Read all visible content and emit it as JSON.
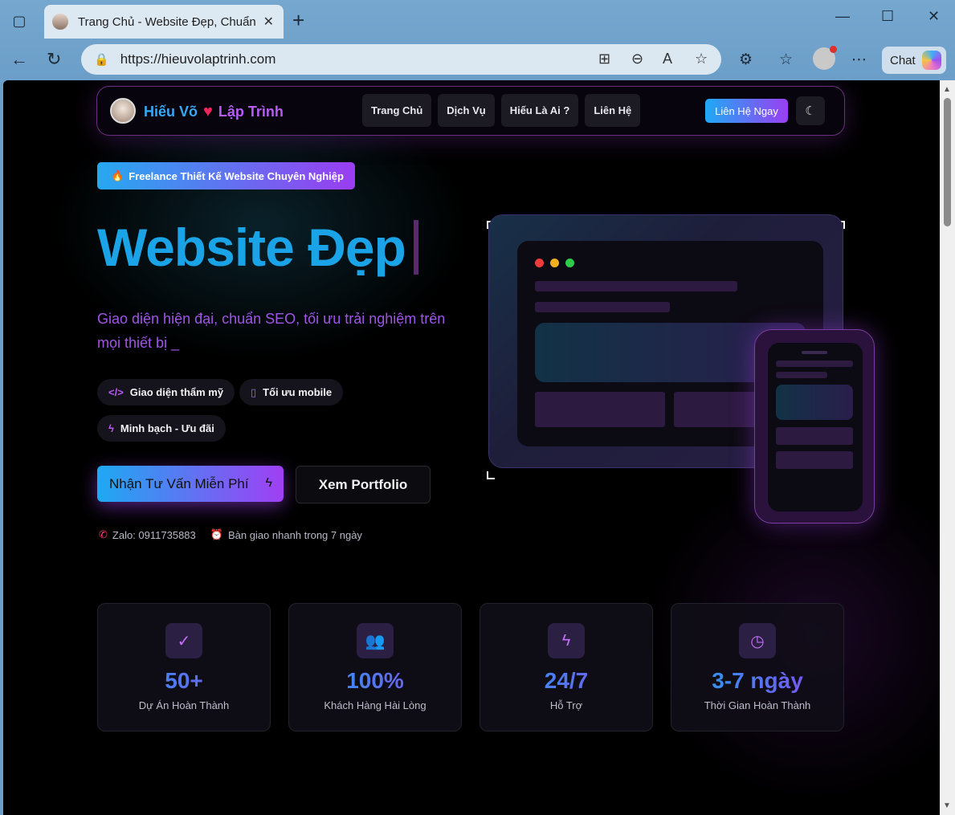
{
  "browser": {
    "tab_title": "Trang Chủ - Website Đẹp, Chuẩn SEO",
    "url": "https://hieuvolaptrinh.com",
    "chat_label": "Chat"
  },
  "nav": {
    "brand_first": "Hiếu Võ",
    "brand_second": "Lập Trình",
    "links": [
      "Trang Chủ",
      "Dịch Vụ",
      "Hiếu Là Ai ?",
      "Liên Hệ"
    ],
    "contact_button": "Liên Hệ Ngay"
  },
  "hero": {
    "badge": "Freelance Thiết Kế Website Chuyên Nghiệp",
    "title": "Website Đẹp",
    "subtitle": "Giao diện hiện đại, chuẩn SEO, tối ưu trải nghiệm trên mọi thiết bị _",
    "features": [
      "Giao diện thẩm mỹ",
      "Tối ưu mobile",
      "Minh bạch - Ưu đãi"
    ],
    "cta_primary": "Nhận Tư Vấn Miễn Phí",
    "cta_secondary": "Xem Portfolio",
    "zalo": "Zalo: 0911735883",
    "delivery": "Bàn giao nhanh trong 7 ngày"
  },
  "stats": [
    {
      "value": "50+",
      "label": "Dự Án Hoàn Thành",
      "icon": "check-circle-icon"
    },
    {
      "value": "100%",
      "label": "Khách Hàng Hài Lòng",
      "icon": "users-icon"
    },
    {
      "value": "24/7",
      "label": "Hỗ Trợ",
      "icon": "lightning-icon"
    },
    {
      "value": "3-7 ngày",
      "label": "Thời Gian Hoàn Thành",
      "icon": "clock-icon"
    }
  ],
  "colors": {
    "accent_blue": "#1aa3e6",
    "accent_purple": "#a03ff3",
    "heart": "#f0245a",
    "page_bg": "#000000"
  }
}
